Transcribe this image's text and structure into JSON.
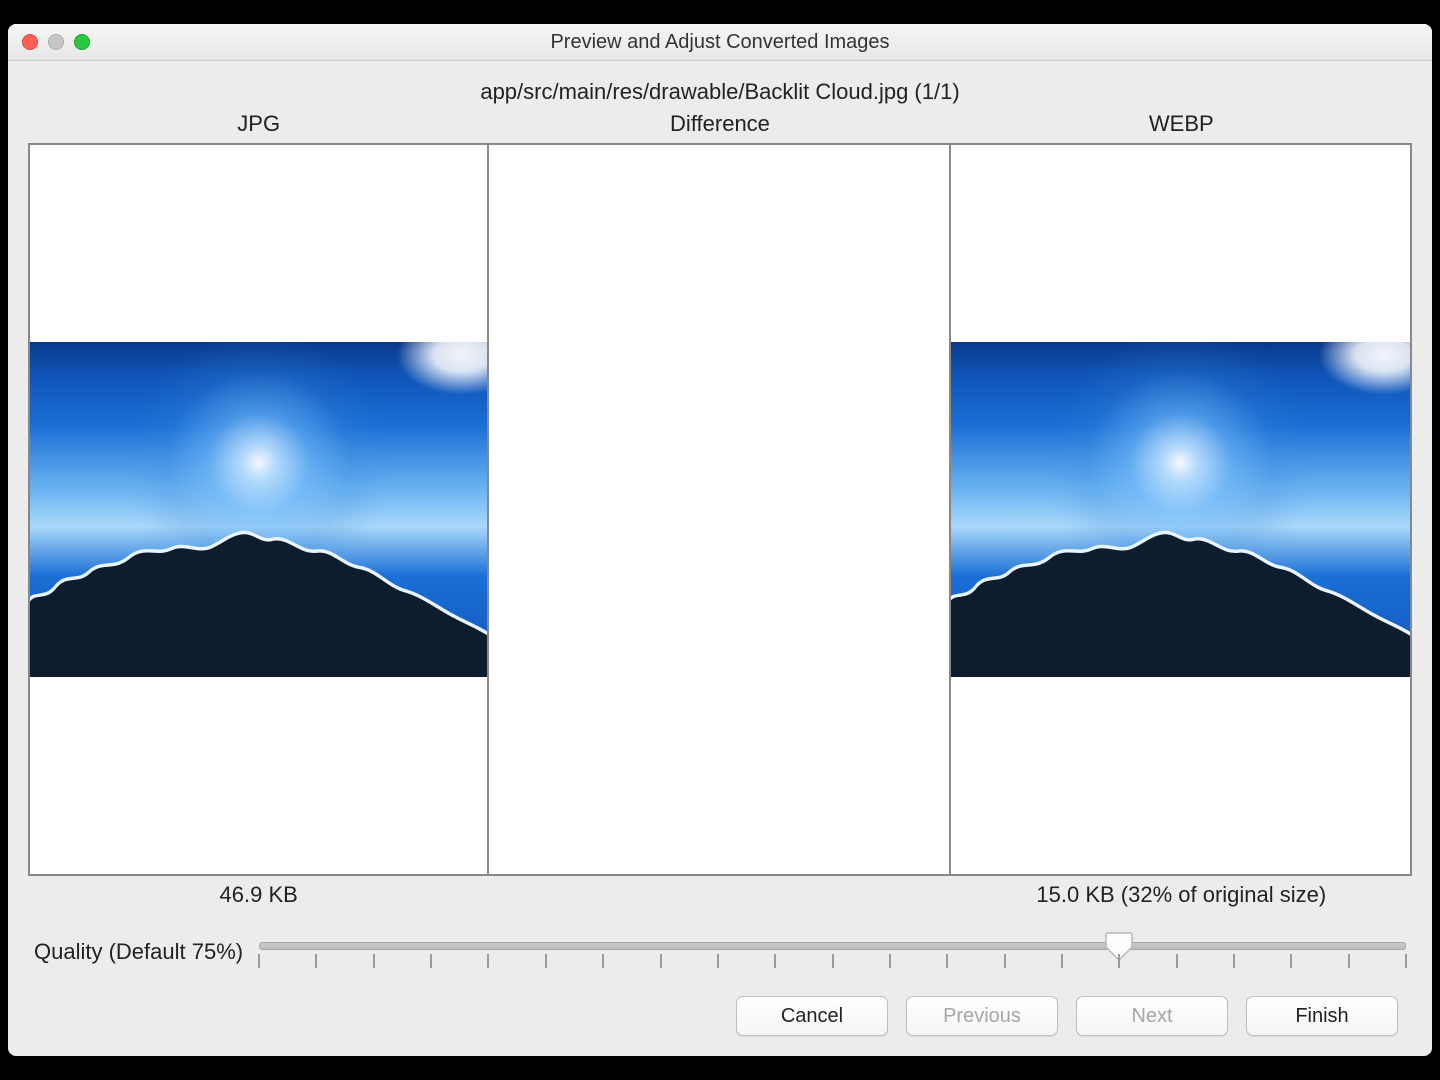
{
  "window": {
    "title": "Preview and Adjust Converted Images"
  },
  "file": {
    "path": "app/src/main/res/drawable/Backlit Cloud.jpg (1/1)"
  },
  "panels": {
    "left": {
      "header": "JPG",
      "footer": "46.9 KB"
    },
    "middle": {
      "header": "Difference",
      "footer": ""
    },
    "right": {
      "header": "WEBP",
      "footer": "15.0 KB (32% of original size)"
    }
  },
  "quality": {
    "label": "Quality (Default 75%)",
    "value_percent": 75,
    "default_percent": 75,
    "min": 0,
    "max": 100,
    "tick_count": 21
  },
  "buttons": {
    "cancel": "Cancel",
    "previous": "Previous",
    "next": "Next",
    "finish": "Finish"
  },
  "button_state": {
    "previous_enabled": false,
    "next_enabled": false
  },
  "icons": {
    "close": "close-icon",
    "minimize": "minimize-icon",
    "zoom": "zoom-icon"
  }
}
